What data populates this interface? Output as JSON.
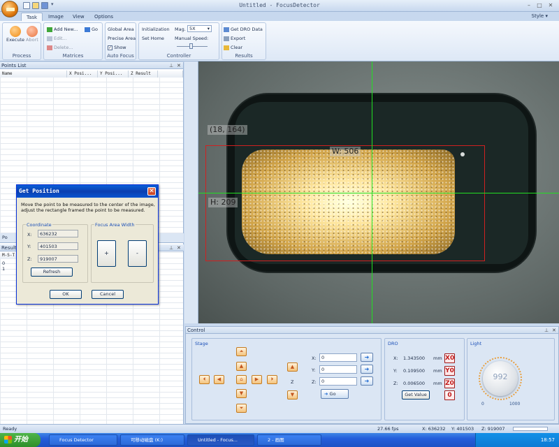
{
  "window": {
    "title": "Untitled - FocusDetector",
    "style_label": "Style"
  },
  "tabs": [
    "Task",
    "Image",
    "View",
    "Options"
  ],
  "ribbon": {
    "process": {
      "label": "Process",
      "execute": "Execute",
      "abort": "Abort"
    },
    "matrices": {
      "label": "Matrices",
      "add_new": "Add New...",
      "go": "Go",
      "edit": "Edit...",
      "delete": "Delete..."
    },
    "auto_focus": {
      "label": "Auto Focus",
      "global_area": "Global Area",
      "precise_area": "Precise Area",
      "show": "Show"
    },
    "controller": {
      "label": "Controller",
      "initialization": "Initialization",
      "set_home": "Set Home",
      "mag_label": "Mag.",
      "mag_value": "5X",
      "manual_speed": "Manual Speed:"
    },
    "results": {
      "label": "Results",
      "get_dro": "Get DRO Data",
      "export": "Export",
      "clear": "Clear"
    }
  },
  "points_list": {
    "title": "Points List",
    "columns": [
      "Name",
      "X Posi...",
      "Y Posi...",
      "Z Result"
    ]
  },
  "results_panel": {
    "title": "Results",
    "column_fragment": "M-S-T",
    "tab_fragment": "Po",
    "rows": [
      "0",
      "1"
    ]
  },
  "viewer": {
    "coord_label": "(18, 164)",
    "width_label": "W: 506",
    "height_label": "H: 209"
  },
  "dialog": {
    "title": "Get Position",
    "instructions": "Move the point to be measured to the center of the image, adjust the rectangle framed the point to be measured.",
    "coordinate_legend": "Coordinate",
    "x_label": "X:",
    "x_value": "636232",
    "y_label": "Y:",
    "y_value": "401503",
    "z_label": "Z:",
    "z_value": "919007",
    "refresh": "Refresh",
    "focus_legend": "Focus Area Width",
    "plus": "+",
    "minus": "-",
    "ok": "OK",
    "cancel": "Cancel"
  },
  "control": {
    "title": "Control",
    "stage_label": "Stage",
    "z_label": "Z",
    "x_label": "X:",
    "x_input": "0",
    "y_label": "Y:",
    "y_input": "0",
    "z_input_label": "Z:",
    "z_input": "0",
    "go": "Go",
    "dro_label": "DRO",
    "dro_x_label": "X:",
    "dro_x": "1.343500",
    "dro_y_label": "Y:",
    "dro_y": "0.109500",
    "dro_z_label": "Z:",
    "dro_z": "0.006500",
    "unit": "mm",
    "get_value": "Get Value",
    "zero_x": "X0",
    "zero_y": "Y0",
    "zero_z": "Z0",
    "zero_all": "0",
    "light_label": "Light",
    "light_value": "992",
    "light_min": "0",
    "light_max": "1000"
  },
  "status": {
    "left": "Ready",
    "fps": "27.66 fps",
    "x": "X: 636232",
    "y": "Y: 401503",
    "z": "Z: 919007"
  },
  "taskbar": {
    "start": "开始",
    "tasks": [
      "Focus Detector",
      "可移动磁盘 (K:)",
      "Untitled - Focus...",
      "2 - 画图"
    ],
    "clock": "18:57"
  },
  "colors": {
    "selection_rect": "#d02020",
    "crosshair": "#22e022",
    "title_blue": "#0b3fb0"
  }
}
